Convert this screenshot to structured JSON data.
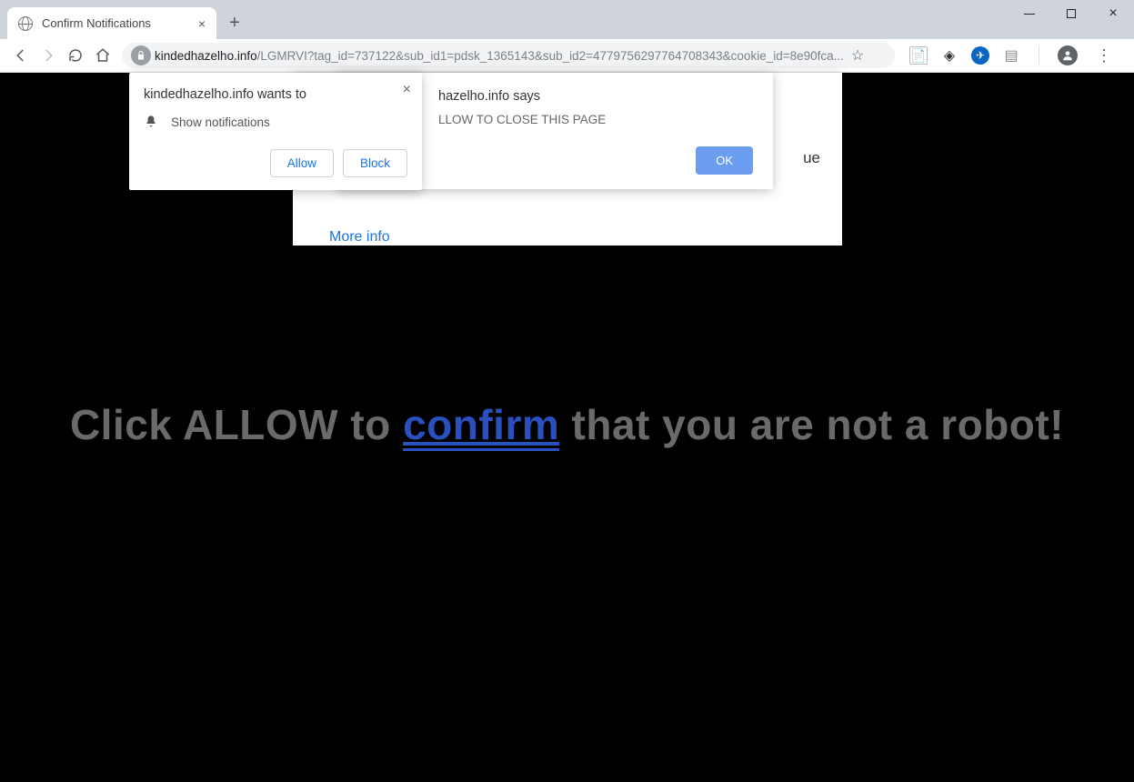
{
  "window": {
    "tab_title": "Confirm Notifications"
  },
  "toolbar": {
    "url_host": "kindedhazelho.info",
    "url_rest": "/LGMRVI?tag_id=737122&sub_id1=pdsk_1365143&sub_id2=4779756297764708343&cookie_id=8e90fca..."
  },
  "perm_prompt": {
    "title": "kindedhazelho.info wants to",
    "row_label": "Show notifications",
    "allow_label": "Allow",
    "block_label": "Block"
  },
  "js_alert": {
    "title_suffix": "hazelho.info says",
    "body_visible": "LLOW TO CLOSE THIS PAGE",
    "ok_label": "OK"
  },
  "fake_card": {
    "right_fragment": "ue",
    "more_info": "More info"
  },
  "page": {
    "msg_part1": "Click ALLOW to ",
    "msg_confirm": "confirm",
    "msg_part2": " that you are not a robot!"
  }
}
